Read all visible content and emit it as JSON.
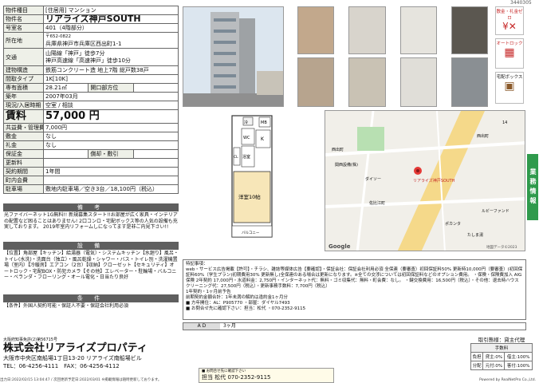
{
  "corner_no": "3440305",
  "spec": {
    "category_label": "物件種目",
    "category": "[住居用] マンション",
    "name_label": "物件名",
    "name": "リアライズ神戸SOUTH",
    "room_label": "号室名",
    "room": "401（4階部分）",
    "address_label": "所在地",
    "zip": "〒652-0822",
    "address": "兵庫県神戸市兵庫区西出町1-1",
    "access_label": "交通",
    "access1": "山陽線「神戸」徒歩7分",
    "access2": "神戸高速線「高速神戸」徒歩10分",
    "structure_label": "建物構造",
    "structure": "鉄筋コンクリート造 地上7階 総戸数38戸",
    "layout_label": "間取タイプ",
    "layout": "1K[10K]",
    "area_label": "専有面積",
    "area": "28.21㎡",
    "opening_label": "開口部方位",
    "opening": "",
    "built_label": "築年",
    "built": "2007年03月",
    "status_label": "現況/入居時期",
    "status": "空室 / 相談",
    "rent_label": "賃料",
    "rent": "57,000 円",
    "fee_label": "共益費・管理費",
    "fee": "7,000円",
    "deposit_label": "敷金",
    "deposit": "なし",
    "keymoney_label": "礼金",
    "keymoney": "なし",
    "guarantee_label": "保証金",
    "guarantee": "",
    "amortize_label": "償却・敷引",
    "amortize": "",
    "renewal_label": "更新料",
    "renewal": "",
    "contract_label": "契約期間",
    "contract": "1年間",
    "town_label": "町内会費",
    "town": "",
    "parking_label": "駐車場",
    "parking": "敷地内駐車場／空き3台／18,100円（税込）"
  },
  "remarks_header": "備 考",
  "remarks_text": "光ファイバーネット1G無料!! 新規募集スタート!!お部屋が広く家具・インテリアの配置など困ることはありません! 2口コンロ・宅配ボックス等の人気の設備も充実しております。 2019年室内リフォームしになってます是非ご内見下さい!!",
  "equip_header": "設 備",
  "equip_text": "【位置】角部屋【キッチン】給湯器（電気）・システムキッチン【水廻り】風呂・トイレ(水洗)・洗面台（独立）・風呂乾燥・シャワー・バス・トイレ別・洗濯機置場（室内）【冷暖房】エアコン（2台）【収納】クローゼット【セキュリティ】オートロック・宅配BOX・防犯カメラ【その他】エレベーター・駐輪場・バルコニー・ベランダ・フローリング・オール電化・日当たり良好",
  "cond_header": "条 件",
  "cond_text": "【条件】外国人契約可能・保証人不要・保証会社利用必須",
  "plan": {
    "western": "洋室10帖",
    "balcony": "バルコニー",
    "kitchen": "K",
    "wc": "WC",
    "bath": "浴室",
    "cl": "CL",
    "mb": "MB",
    "ref": "冷"
  },
  "map": {
    "attribution": "Google",
    "copyright": "地図データ©2023",
    "labels": [
      "西出町",
      "関西設備(株)",
      "ダイソー",
      "佐比江町",
      "西出町",
      "ポカンタ",
      "たしま湯",
      "14",
      "ルビーファンド"
    ],
    "station": "リアライズ神戸SOUTH"
  },
  "badges": {
    "free": "敷金・礼金ゼロ",
    "autolock": "オートロック",
    "delivery": "宅配ボックス"
  },
  "side_tab": "業務情報",
  "remarks_box": {
    "title": "特記事項：",
    "text": "web・サービス広告掲載【許可】・チラシ、雑誌等媒体広告【要確認】・保証会社：保証会社利用必須 全保連（要審査）初回保証料50% 更新時10,000円（要審査）(初回保証料60%（学生プラン)初期費用30% 更新無し)全保連のある場合は更新になります。※全ての交渉については初回保証料などのオプション費用。 ・保険・保険費加入 AIG保険 2年契約 17,000円・水道料金：2,750円・インターネット代：無料・ゴミ収集代：無料・町会費：なし。 ・鍵交換費用：16,500円（税込）・その他：退去時ハウスクリーニング代：27,500円（税込）・更新事務手数料：7,700円（税込）",
    "line2": "1年契約・1ヶ月前予告",
    "line3": "前期契約金額合計：1年未満の解約は違約金1ヶ月分",
    "manager": "■ 方年開住：AL：P905770 ・部屋：ダイヤル7493",
    "inquiry": "■ お問合せ先に確認下さい：担当：松代 ・070-2352-9115"
  },
  "ad_label": "A D",
  "ad_value": "3ヶ月",
  "company": {
    "license": "大阪府知事免許(2)第56715号",
    "name": "株式会社リアライズプロパティ",
    "address": "大阪市中央区南船場1丁目13-20 リアライズ南船場ビル",
    "tel": "TEL：06-4256-4111　FAX：06-4256-4112"
  },
  "contact": {
    "note": "■ お問合せ先に確認下さい",
    "person_label": "担当",
    "person": "松代",
    "phone": "070-2352-9115"
  },
  "terms": {
    "title": "取引態様：貸主代理",
    "fee_title": "手数料",
    "rows": [
      [
        "負担",
        "貸主:0%",
        "借主:100%"
      ],
      [
        "分配",
        "元付:0%",
        "客付:100%"
      ]
    ]
  },
  "footer_left": "出力日:2022/02/15 13:04:47 / 次回更新予定日:2022/03/01 ※掲載情報は随時更新しております。",
  "footer_right": "Powered by RealNetPro Co.,Ltd.",
  "colors": {
    "green": "#2f9a4c",
    "header": "#5f5f5f",
    "keycell": "#eef0e8"
  }
}
